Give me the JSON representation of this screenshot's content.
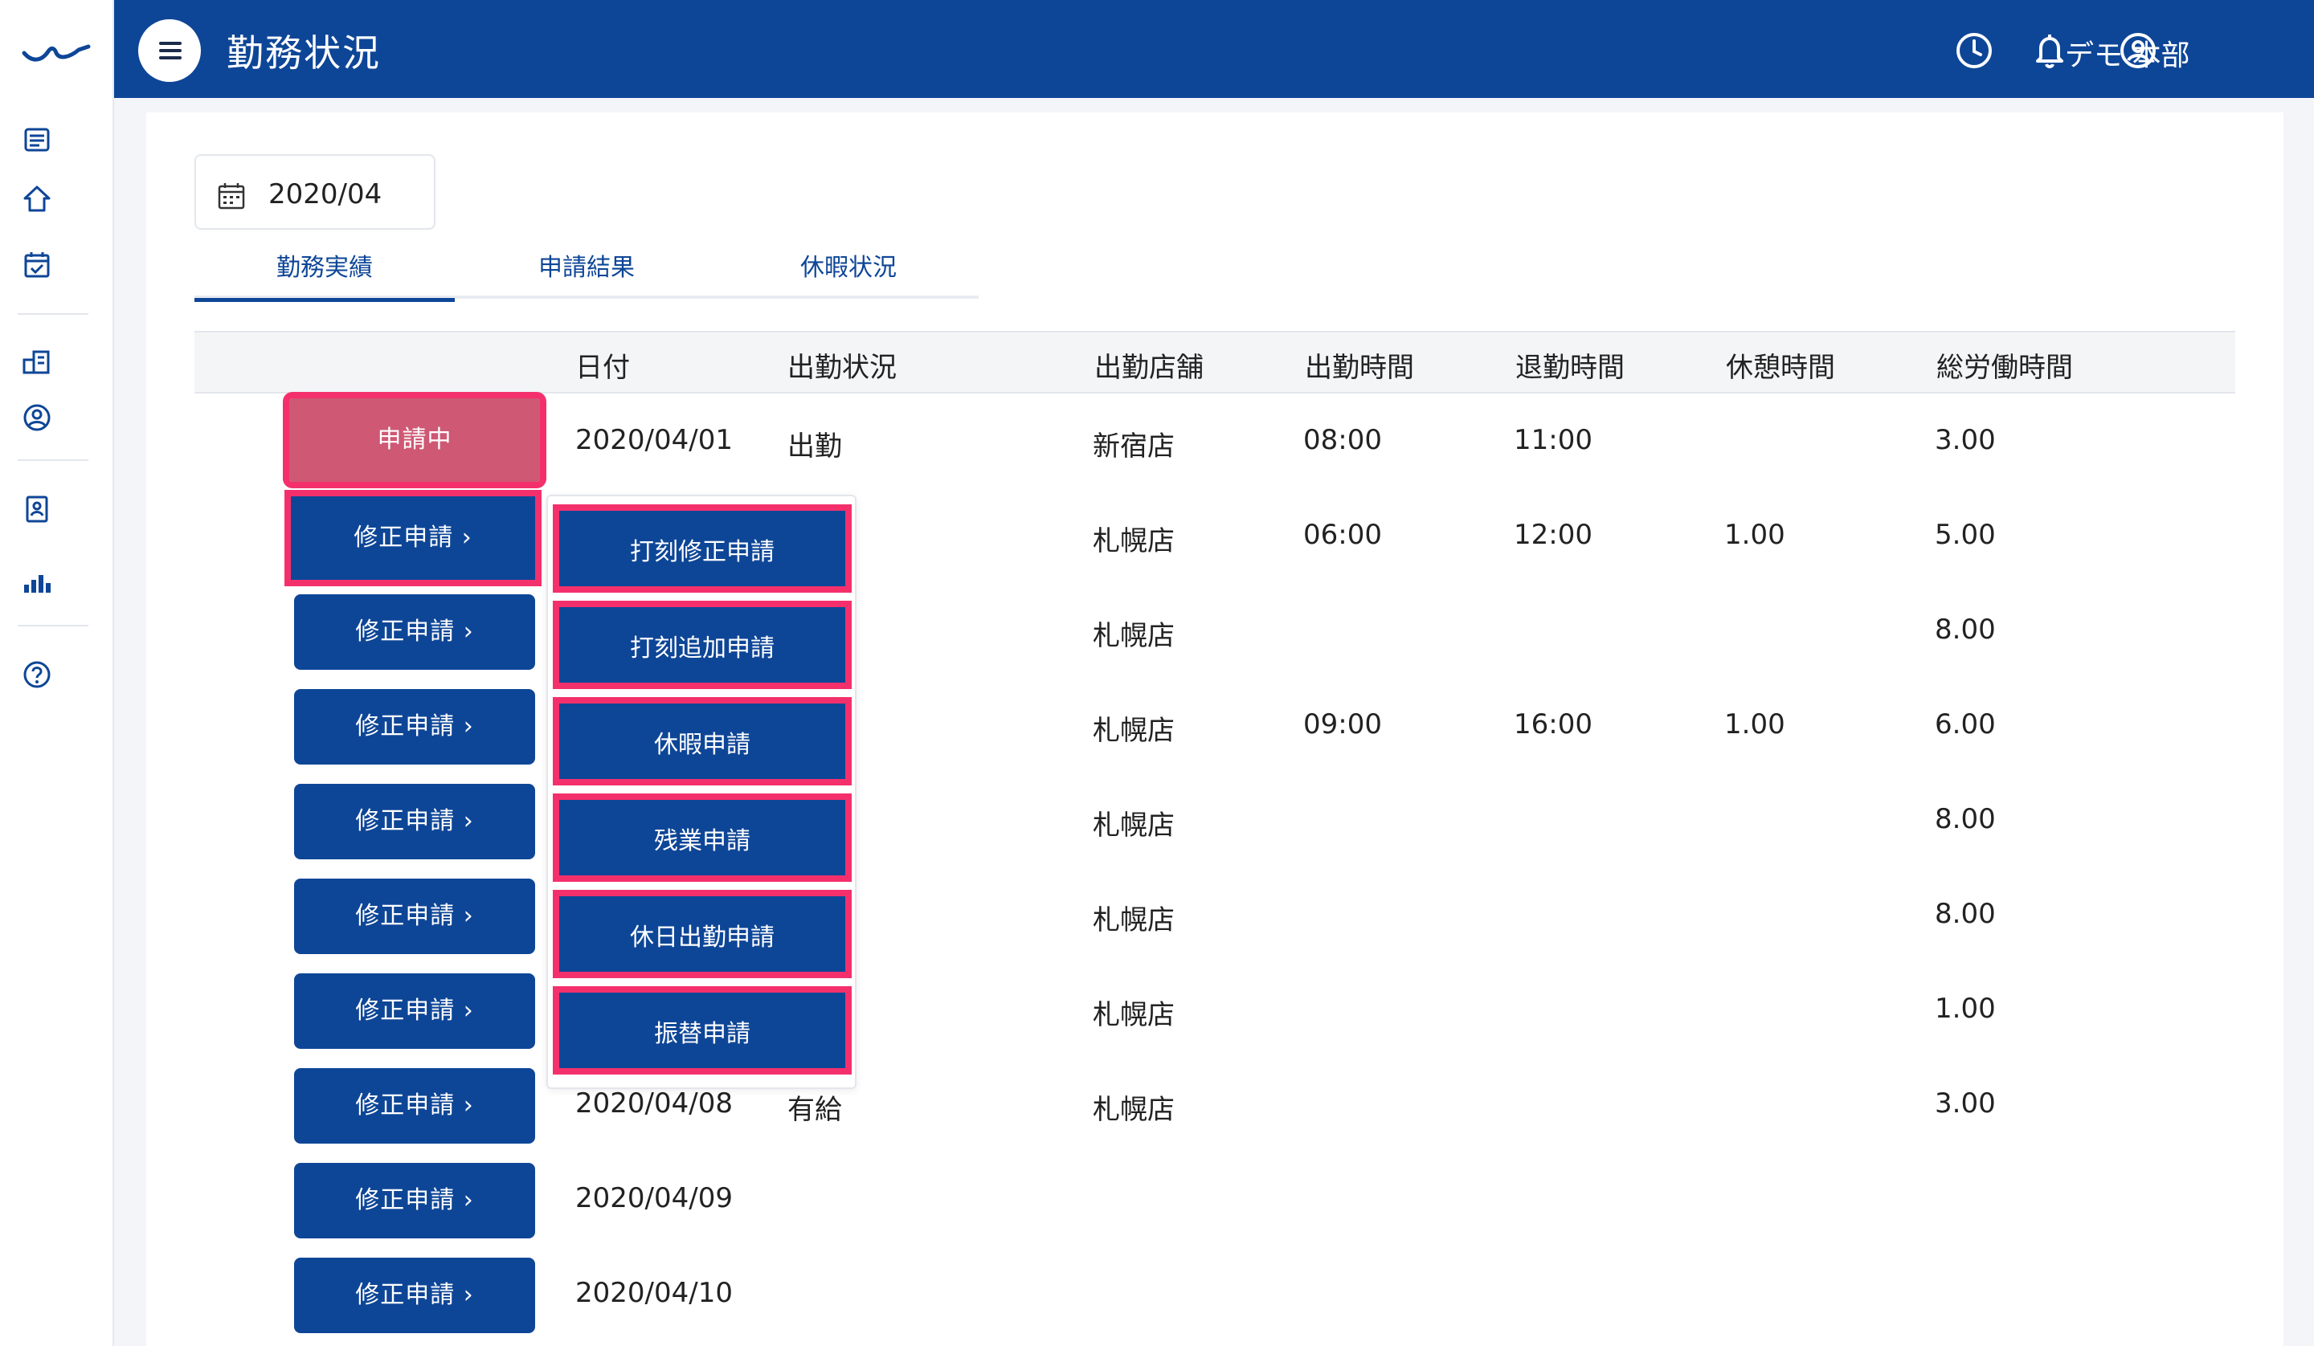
{
  "app": {
    "title": "勤務状況",
    "user_name": "デモ 本部"
  },
  "sidebar": {
    "items": [
      {
        "icon": "list-icon"
      },
      {
        "icon": "home-icon"
      },
      {
        "icon": "calendar-check-icon"
      },
      {
        "icon": "building-icon"
      },
      {
        "icon": "user-circle-icon"
      },
      {
        "icon": "id-badge-icon"
      },
      {
        "icon": "bar-chart-icon"
      },
      {
        "icon": "help-icon"
      }
    ]
  },
  "header": {
    "icons": [
      "clock-icon",
      "bell-icon",
      "account-icon"
    ]
  },
  "filter": {
    "month": "2020/04"
  },
  "tabs": [
    {
      "label": "勤務実績",
      "active": true
    },
    {
      "label": "申請結果",
      "active": false
    },
    {
      "label": "休暇状況",
      "active": false
    }
  ],
  "table": {
    "columns": [
      "日付",
      "出勤状況",
      "出勤店舗",
      "出勤時間",
      "退勤時間",
      "休憩時間",
      "総労働時間"
    ],
    "rows": [
      {
        "action": "申請中",
        "date": "2020/04/01",
        "status": "出勤",
        "store": "新宿店",
        "in": "08:00",
        "out": "11:00",
        "break": "",
        "total": "3.00"
      },
      {
        "action": "修正申請 ›",
        "date": "",
        "status": "",
        "store": "札幌店",
        "in": "06:00",
        "out": "12:00",
        "break": "1.00",
        "total": "5.00"
      },
      {
        "action": "修正申請 ›",
        "date": "",
        "status": "",
        "store": "札幌店",
        "in": "",
        "out": "",
        "break": "",
        "total": "8.00"
      },
      {
        "action": "修正申請 ›",
        "date": "",
        "status": "",
        "store": "札幌店",
        "in": "09:00",
        "out": "16:00",
        "break": "1.00",
        "total": "6.00"
      },
      {
        "action": "修正申請 ›",
        "date": "",
        "status": "",
        "store": "札幌店",
        "in": "",
        "out": "",
        "break": "",
        "total": "8.00"
      },
      {
        "action": "修正申請 ›",
        "date": "",
        "status": "",
        "store": "札幌店",
        "in": "",
        "out": "",
        "break": "",
        "total": "8.00"
      },
      {
        "action": "修正申請 ›",
        "date": "",
        "status": "",
        "store": "札幌店",
        "in": "",
        "out": "",
        "break": "",
        "total": "1.00"
      },
      {
        "action": "修正申請 ›",
        "date": "2020/04/08",
        "status": "有給",
        "store": "札幌店",
        "in": "",
        "out": "",
        "break": "",
        "total": "3.00"
      },
      {
        "action": "修正申請 ›",
        "date": "2020/04/09",
        "status": "",
        "store": "",
        "in": "",
        "out": "",
        "break": "",
        "total": ""
      },
      {
        "action": "修正申請 ›",
        "date": "2020/04/10",
        "status": "",
        "store": "",
        "in": "",
        "out": "",
        "break": "",
        "total": ""
      }
    ]
  },
  "popup_menu": {
    "items": [
      "打刻修正申請",
      "打刻追加申請",
      "休暇申請",
      "残業申請",
      "休日出勤申請",
      "振替申請"
    ]
  },
  "colors": {
    "primary": "#0e4697",
    "pending": "#cf5874",
    "highlight": "#f4306c"
  }
}
